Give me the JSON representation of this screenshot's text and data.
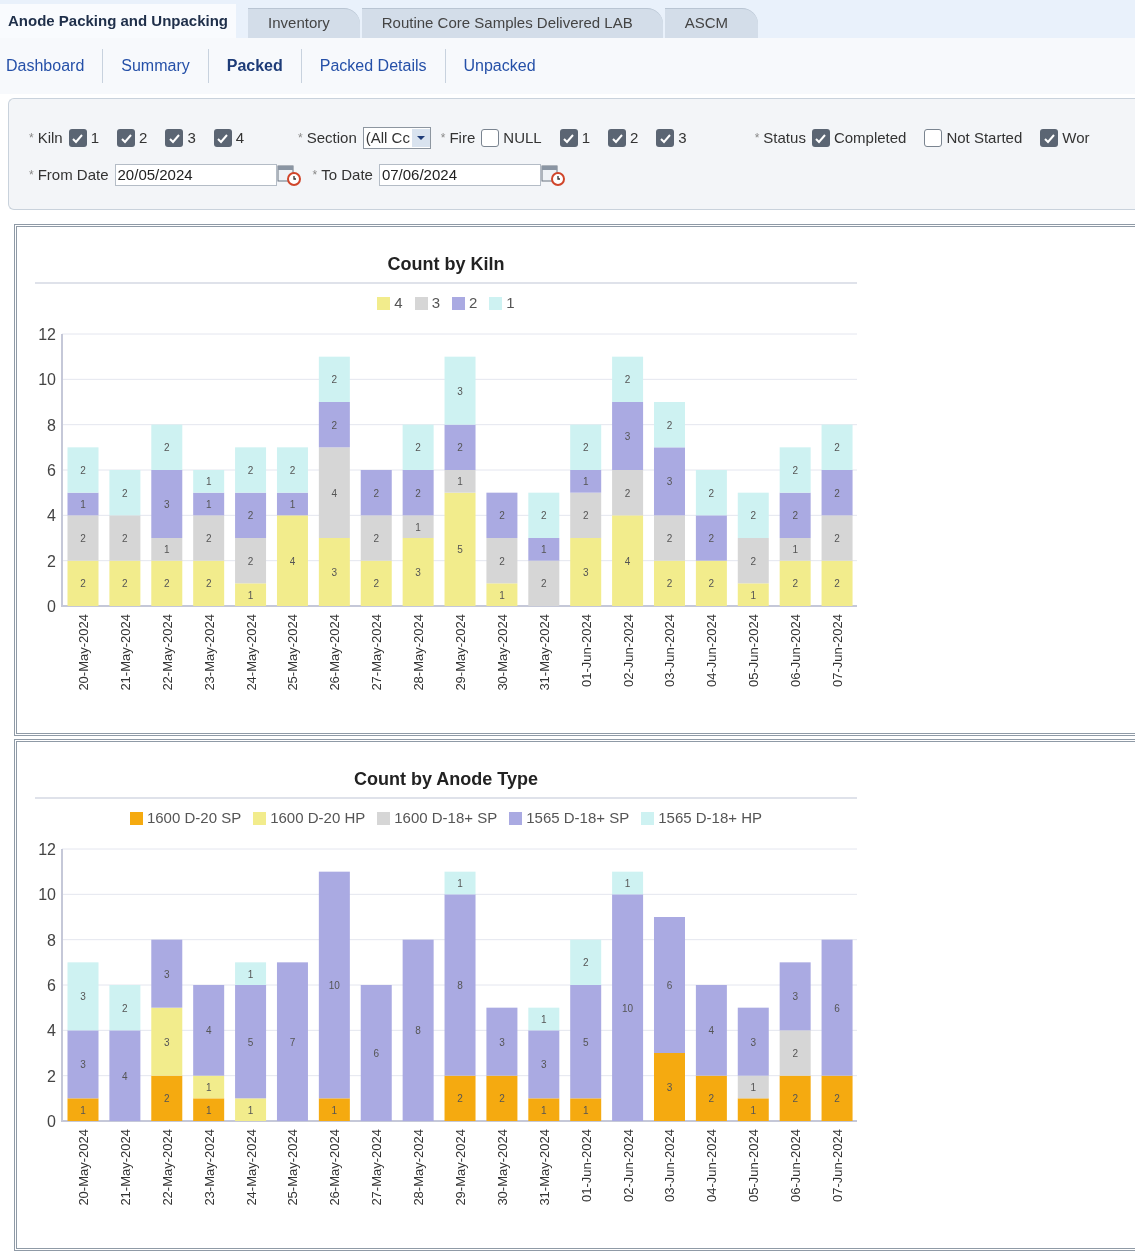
{
  "app_tabs": [
    {
      "label": "Anode Packing and Unpacking",
      "selected": true
    },
    {
      "label": "Inventory",
      "selected": false
    },
    {
      "label": "Routine Core Samples Delivered LAB",
      "selected": false
    },
    {
      "label": "ASCM",
      "selected": false
    }
  ],
  "sub_tabs": [
    {
      "label": "Dashboard",
      "selected": false
    },
    {
      "label": "Summary",
      "selected": false
    },
    {
      "label": "Packed",
      "selected": true
    },
    {
      "label": "Packed Details",
      "selected": false
    },
    {
      "label": "Unpacked",
      "selected": false
    }
  ],
  "filters": {
    "kiln": {
      "required_mark": "*",
      "label": "Kiln",
      "options": [
        {
          "label": "1",
          "checked": true
        },
        {
          "label": "2",
          "checked": true
        },
        {
          "label": "3",
          "checked": true
        },
        {
          "label": "4",
          "checked": true
        }
      ]
    },
    "section": {
      "required_mark": "*",
      "label": "Section",
      "value": "(All Cc"
    },
    "fire": {
      "required_mark": "*",
      "label": "Fire",
      "options": [
        {
          "label": "NULL",
          "checked": false
        },
        {
          "label": "1",
          "checked": true
        },
        {
          "label": "2",
          "checked": true
        },
        {
          "label": "3",
          "checked": true
        }
      ]
    },
    "status": {
      "required_mark": "*",
      "label": "Status",
      "options": [
        {
          "label": "Completed",
          "checked": true
        },
        {
          "label": "Not Started",
          "checked": false
        },
        {
          "label": "Wor",
          "checked": true
        }
      ]
    },
    "from_date": {
      "required_mark": "*",
      "label": "From Date",
      "value": "20/05/2024"
    },
    "to_date": {
      "required_mark": "*",
      "label": "To Date",
      "value": "07/06/2024"
    }
  },
  "charts": [
    {
      "chart_data": {
        "type": "bar",
        "title": "Count by Kiln",
        "stacked": true,
        "grid": true,
        "legend": true,
        "data_labels": true,
        "ylim": [
          0,
          12
        ],
        "yticks": [
          0,
          2,
          4,
          6,
          8,
          10,
          12
        ],
        "categories": [
          "20-May-2024",
          "21-May-2024",
          "22-May-2024",
          "23-May-2024",
          "24-May-2024",
          "25-May-2024",
          "26-May-2024",
          "27-May-2024",
          "28-May-2024",
          "29-May-2024",
          "30-May-2024",
          "31-May-2024",
          "01-Jun-2024",
          "02-Jun-2024",
          "03-Jun-2024",
          "04-Jun-2024",
          "05-Jun-2024",
          "06-Jun-2024",
          "07-Jun-2024"
        ],
        "series": [
          {
            "name": "4",
            "color": "#f2ec8c",
            "values": [
              2,
              2,
              2,
              2,
              1,
              4,
              3,
              2,
              3,
              5,
              1,
              null,
              3,
              4,
              2,
              2,
              1,
              2,
              2
            ]
          },
          {
            "name": "3",
            "color": "#d6d6d6",
            "values": [
              2,
              2,
              1,
              2,
              2,
              null,
              4,
              2,
              1,
              1,
              2,
              2,
              2,
              2,
              2,
              null,
              2,
              1,
              2
            ]
          },
          {
            "name": "2",
            "color": "#aaaae2",
            "values": [
              1,
              null,
              3,
              1,
              2,
              1,
              2,
              2,
              2,
              2,
              2,
              1,
              1,
              3,
              3,
              2,
              null,
              2,
              2
            ]
          },
          {
            "name": "1",
            "color": "#cef2f2",
            "values": [
              2,
              2,
              2,
              1,
              2,
              2,
              2,
              null,
              2,
              3,
              null,
              2,
              2,
              2,
              2,
              2,
              2,
              2,
              2
            ]
          }
        ]
      }
    },
    {
      "chart_data": {
        "type": "bar",
        "title": "Count by Anode Type",
        "stacked": true,
        "grid": true,
        "legend": true,
        "data_labels": true,
        "ylim": [
          0,
          12
        ],
        "yticks": [
          0,
          2,
          4,
          6,
          8,
          10,
          12
        ],
        "categories": [
          "20-May-2024",
          "21-May-2024",
          "22-May-2024",
          "23-May-2024",
          "24-May-2024",
          "25-May-2024",
          "26-May-2024",
          "27-May-2024",
          "28-May-2024",
          "29-May-2024",
          "30-May-2024",
          "31-May-2024",
          "01-Jun-2024",
          "02-Jun-2024",
          "03-Jun-2024",
          "04-Jun-2024",
          "05-Jun-2024",
          "06-Jun-2024",
          "07-Jun-2024"
        ],
        "series": [
          {
            "name": "1600 D-20 SP",
            "color": "#f5aa10",
            "values": [
              1,
              null,
              2,
              1,
              null,
              null,
              1,
              null,
              null,
              2,
              2,
              1,
              1,
              null,
              3,
              2,
              1,
              2,
              2
            ]
          },
          {
            "name": "1600 D-20 HP",
            "color": "#f2ec8c",
            "values": [
              null,
              null,
              3,
              1,
              1,
              null,
              null,
              null,
              null,
              null,
              null,
              null,
              null,
              null,
              null,
              null,
              null,
              null,
              null
            ]
          },
          {
            "name": "1600 D-18+ SP",
            "color": "#d6d6d6",
            "values": [
              null,
              null,
              null,
              null,
              null,
              null,
              null,
              null,
              null,
              null,
              null,
              null,
              null,
              null,
              null,
              null,
              1,
              2,
              null
            ]
          },
          {
            "name": "1565 D-18+ SP",
            "color": "#aaaae2",
            "values": [
              3,
              4,
              3,
              4,
              5,
              7,
              10,
              6,
              8,
              8,
              3,
              3,
              5,
              10,
              6,
              4,
              3,
              3,
              6
            ]
          },
          {
            "name": "1565 D-18+ HP",
            "color": "#cef2f2",
            "values": [
              3,
              2,
              null,
              null,
              1,
              null,
              null,
              null,
              null,
              1,
              null,
              1,
              2,
              1,
              null,
              null,
              null,
              null,
              null
            ]
          }
        ]
      }
    }
  ]
}
